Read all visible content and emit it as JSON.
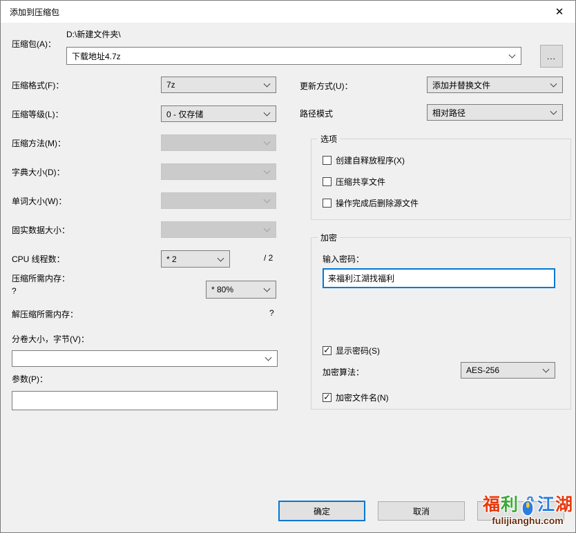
{
  "window": {
    "title": "添加到压缩包",
    "close_glyph": "✕"
  },
  "archive": {
    "label": "压缩包(A)：",
    "dir": "D:\\新建文件夹\\",
    "filename": "下载地址4.7z",
    "browse": "..."
  },
  "format": {
    "label": "压缩格式(F)：",
    "value": "7z"
  },
  "level": {
    "label": "压缩等级(L)：",
    "value": "0 - 仅存储"
  },
  "method": {
    "label": "压缩方法(M)：",
    "value": "",
    "disabled": true
  },
  "dict": {
    "label": "字典大小(D)：",
    "value": "",
    "disabled": true
  },
  "word": {
    "label": "单词大小(W)：",
    "value": "",
    "disabled": true
  },
  "solid": {
    "label": "固实数据大小：",
    "value": "",
    "disabled": true
  },
  "cpu": {
    "label": "CPU 线程数：",
    "value": "* 2",
    "max": "/ 2"
  },
  "mem": {
    "label": "压缩所需内存：",
    "unknown": "?",
    "value": "* 80%"
  },
  "mem_decompress": {
    "label": "解压缩所需内存：",
    "value": "?"
  },
  "volume": {
    "label": "分卷大小，字节(V)：",
    "value": ""
  },
  "params": {
    "label": "参数(P)：",
    "value": ""
  },
  "update_mode": {
    "label": "更新方式(U)：",
    "value": "添加并替换文件"
  },
  "path_mode": {
    "label": "路径模式",
    "value": "相对路径"
  },
  "options": {
    "title": "选项",
    "items": [
      {
        "label": "创建自释放程序(X)",
        "checked": false
      },
      {
        "label": "压缩共享文件",
        "checked": false
      },
      {
        "label": "操作完成后删除源文件",
        "checked": false
      }
    ]
  },
  "encryption": {
    "title": "加密",
    "password_label": "输入密码：",
    "password": "来福利江湖找福利",
    "show_password": {
      "label": "显示密码(S)",
      "checked": true
    },
    "algorithm": {
      "label": "加密算法：",
      "value": "AES-256"
    },
    "encrypt_names": {
      "label": "加密文件名(N)",
      "checked": true
    }
  },
  "buttons": {
    "ok": "确定",
    "cancel": "取消"
  },
  "watermark": {
    "char1": "福",
    "char2": "利",
    "char3": "江",
    "char4": "湖",
    "domain": "fulijianghu.com",
    "colors": {
      "red": "#e8380d",
      "green": "#3aa935",
      "blue": "#2a7de1",
      "domain": "#6b2e11"
    }
  },
  "accent_color": "#0078d7"
}
